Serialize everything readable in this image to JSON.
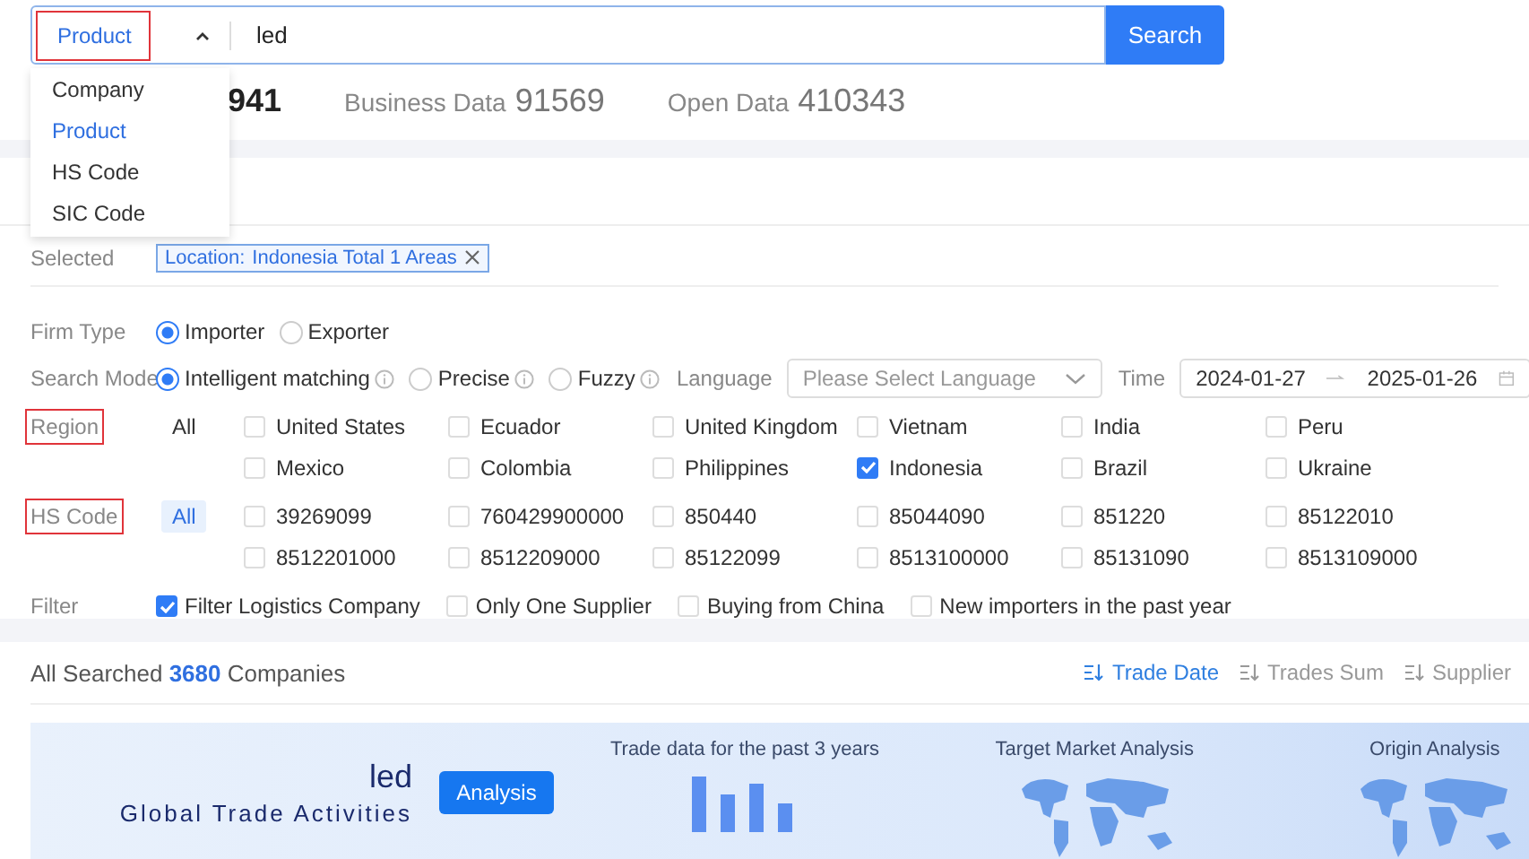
{
  "search": {
    "scope": "Product",
    "scope_highlighted": true,
    "query": "led",
    "button": "Search",
    "menu": [
      {
        "label": "Company",
        "selected": false
      },
      {
        "label": "Product",
        "selected": true
      },
      {
        "label": "HS Code",
        "selected": false
      },
      {
        "label": "SIC Code",
        "selected": false
      }
    ]
  },
  "stats": [
    {
      "value": "941"
    },
    {
      "label": "Business Data",
      "value": "91569"
    },
    {
      "label": "Open Data",
      "value": "410343"
    }
  ],
  "selected": {
    "label": "Selected",
    "tags": [
      {
        "key": "Location:",
        "value": "Indonesia Total 1 Areas"
      }
    ]
  },
  "firm_type": {
    "label": "Firm Type",
    "options": [
      {
        "label": "Importer",
        "selected": true
      },
      {
        "label": "Exporter",
        "selected": false
      }
    ]
  },
  "search_mode": {
    "label": "Search Mode",
    "options": [
      {
        "label": "Intelligent matching",
        "selected": true
      },
      {
        "label": "Precise",
        "selected": false
      },
      {
        "label": "Fuzzy",
        "selected": false
      }
    ]
  },
  "language": {
    "label": "Language",
    "placeholder": "Please Select Language"
  },
  "time": {
    "label": "Time",
    "start": "2024-01-27",
    "end": "2025-01-26"
  },
  "region": {
    "label": "Region",
    "highlighted": true,
    "all": {
      "label": "All",
      "selected": false
    },
    "items": [
      {
        "label": "United States",
        "checked": false
      },
      {
        "label": "Ecuador",
        "checked": false
      },
      {
        "label": "United Kingdom",
        "checked": false
      },
      {
        "label": "Vietnam",
        "checked": false
      },
      {
        "label": "India",
        "checked": false
      },
      {
        "label": "Peru",
        "checked": false
      },
      {
        "label": "Mexico",
        "checked": false
      },
      {
        "label": "Colombia",
        "checked": false
      },
      {
        "label": "Philippines",
        "checked": false
      },
      {
        "label": "Indonesia",
        "checked": true
      },
      {
        "label": "Brazil",
        "checked": false
      },
      {
        "label": "Ukraine",
        "checked": false
      }
    ]
  },
  "hs_code": {
    "label": "HS Code",
    "highlighted": true,
    "all": {
      "label": "All",
      "selected": true
    },
    "items": [
      {
        "label": "39269099",
        "checked": false
      },
      {
        "label": "760429900000",
        "checked": false
      },
      {
        "label": "850440",
        "checked": false
      },
      {
        "label": "85044090",
        "checked": false
      },
      {
        "label": "851220",
        "checked": false
      },
      {
        "label": "85122010",
        "checked": false
      },
      {
        "label": "8512201000",
        "checked": false
      },
      {
        "label": "8512209000",
        "checked": false
      },
      {
        "label": "85122099",
        "checked": false
      },
      {
        "label": "8513100000",
        "checked": false
      },
      {
        "label": "85131090",
        "checked": false
      },
      {
        "label": "8513109000",
        "checked": false
      }
    ]
  },
  "filter": {
    "label": "Filter",
    "items": [
      {
        "label": "Filter Logistics Company",
        "checked": true
      },
      {
        "label": "Only One Supplier",
        "checked": false
      },
      {
        "label": "Buying from China",
        "checked": false
      },
      {
        "label": "New importers in the past year",
        "checked": false
      }
    ]
  },
  "results": {
    "prefix": "All Searched",
    "count": "3680",
    "suffix": "Companies",
    "sorts": [
      {
        "label": "Trade Date",
        "selected": true
      },
      {
        "label": "Trades Sum",
        "selected": false
      },
      {
        "label": "Supplier",
        "selected": false
      }
    ]
  },
  "banner": {
    "keyword": "led",
    "subtitle": "Global Trade Activities",
    "button": "Analysis",
    "panels": [
      {
        "title": "Trade data for the past 3 years",
        "kind": "bars"
      },
      {
        "title": "Target Market Analysis",
        "kind": "map"
      },
      {
        "title": "Origin Analysis",
        "kind": "map"
      }
    ]
  }
}
